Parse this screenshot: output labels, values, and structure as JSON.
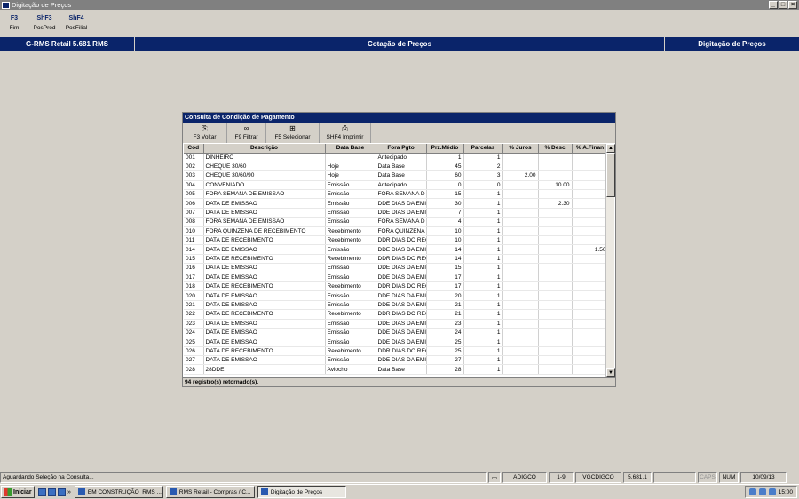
{
  "window": {
    "title": "Digitação de Preços"
  },
  "toolbar": [
    {
      "key": "F3",
      "label": "Fim"
    },
    {
      "key": "ShF3",
      "label": "PosProd"
    },
    {
      "key": "ShF4",
      "label": "PosFilial"
    }
  ],
  "header": {
    "left": "G-RMS Retail 5.681 RMS",
    "center": "Cotação de Preços",
    "right": "Digitação de Preços"
  },
  "dialog": {
    "title": "Consulta de Condição de Pagamento",
    "tools": [
      {
        "icon": "back-icon",
        "label": "F3 Voltar"
      },
      {
        "icon": "binoculars-icon",
        "label": "F9 Filtrar"
      },
      {
        "icon": "select-icon",
        "label": "F5 Selecionar"
      },
      {
        "icon": "printer-icon",
        "label": "SHF4 Imprimir"
      }
    ],
    "columns": [
      "Cód",
      "Descrição",
      "Data Base",
      "Fora Pgto",
      "Prz.Médio",
      "Parcelas",
      "% Juros",
      "% Desc",
      "% A.Finan"
    ],
    "rows": [
      [
        "001",
        "DINHEIRO",
        "",
        "Antecipado",
        "1",
        "1",
        "",
        "",
        ""
      ],
      [
        "002",
        "CHEQUE 30/60",
        "Hoje",
        "Data Base",
        "45",
        "2",
        "",
        "",
        ""
      ],
      [
        "003",
        "CHEQUE 30/60/90",
        "Hoje",
        "Data Base",
        "60",
        "3",
        "2.00",
        "",
        ""
      ],
      [
        "004",
        "CONVENIADO",
        "Emissão",
        "Antecipado",
        "0",
        "0",
        "",
        "10.00",
        ""
      ],
      [
        "005",
        "FORA SEMANA DE EMISSAO",
        "Emissão",
        "FORA SEMANA D",
        "15",
        "1",
        "",
        "",
        ""
      ],
      [
        "006",
        "DATA DE EMISSAO",
        "Emissão",
        "DDE DIAS DA EMI",
        "30",
        "1",
        "",
        "2.30",
        ""
      ],
      [
        "007",
        "DATA DE EMISSAO",
        "Emissão",
        "DDE DIAS DA EMI",
        "7",
        "1",
        "",
        "",
        ""
      ],
      [
        "008",
        "FORA SEMANA DE EMISSAO",
        "Emissão",
        "FORA SEMANA D",
        "4",
        "1",
        "",
        "",
        ""
      ],
      [
        "010",
        "FORA QUINZENA DE RECEBIMENTO",
        "Recebimento",
        "FORA QUINZENA",
        "10",
        "1",
        "",
        "",
        ""
      ],
      [
        "011",
        "DATA DE RECEBIMENTO",
        "Recebimento",
        "DDR DIAS DO REC",
        "10",
        "1",
        "",
        "",
        ""
      ],
      [
        "014",
        "DATA DE EMISSAO",
        "Emissão",
        "DDE DIAS DA EMI",
        "14",
        "1",
        "",
        "",
        "1.50"
      ],
      [
        "015",
        "DATA DE RECEBIMENTO",
        "Recebimento",
        "DDR DIAS DO REC",
        "14",
        "1",
        "",
        "",
        ""
      ],
      [
        "016",
        "DATA DE EMISSAO",
        "Emissão",
        "DDE DIAS DA EMI",
        "15",
        "1",
        "",
        "",
        ""
      ],
      [
        "017",
        "DATA DE EMISSAO",
        "Emissão",
        "DDE DIAS DA EMI",
        "17",
        "1",
        "",
        "",
        ""
      ],
      [
        "018",
        "DATA DE RECEBIMENTO",
        "Recebimento",
        "DDR DIAS DO REC",
        "17",
        "1",
        "",
        "",
        ""
      ],
      [
        "020",
        "DATA DE EMISSAO",
        "Emissão",
        "DDE DIAS DA EMI",
        "20",
        "1",
        "",
        "",
        ""
      ],
      [
        "021",
        "DATA DE EMISSAO",
        "Emissão",
        "DDE DIAS DA EMI",
        "21",
        "1",
        "",
        "",
        ""
      ],
      [
        "022",
        "DATA DE RECEBIMENTO",
        "Recebimento",
        "DDR DIAS DO REC",
        "21",
        "1",
        "",
        "",
        ""
      ],
      [
        "023",
        "DATA DE EMISSAO",
        "Emissão",
        "DDE DIAS DA EMI",
        "23",
        "1",
        "",
        "",
        ""
      ],
      [
        "024",
        "DATA DE EMISSAO",
        "Emissão",
        "DDE DIAS DA EMI",
        "24",
        "1",
        "",
        "",
        ""
      ],
      [
        "025",
        "DATA DE EMISSAO",
        "Emissão",
        "DDE DIAS DA EMI",
        "25",
        "1",
        "",
        "",
        ""
      ],
      [
        "026",
        "DATA DE RECEBIMENTO",
        "Recebimento",
        "DDR DIAS DO REC",
        "25",
        "1",
        "",
        "",
        ""
      ],
      [
        "027",
        "DATA DE EMISSAO",
        "Emissão",
        "DDE DIAS DA EMI",
        "27",
        "1",
        "",
        "",
        ""
      ],
      [
        "028",
        "28DDE",
        "Aviocho",
        "Data Base",
        "28",
        "1",
        "",
        "",
        ""
      ]
    ],
    "status": "94 registro(s) retornado(s)."
  },
  "statusbar": {
    "message": "Aguardando Seleção na Consulta...",
    "user": "ADIGCO",
    "range": "1-9",
    "program": "VGCDIGCO",
    "version": "5.681.1",
    "caps": "CAPS",
    "num": "NUM",
    "date": "10/09/13"
  },
  "taskbar": {
    "start": "Iniciar",
    "tasks": [
      "EM CONSTRUÇÃO_RMS ...",
      "RMS Retail - Compras / C...",
      "Digitação de Preços"
    ],
    "clock": "15:00"
  }
}
